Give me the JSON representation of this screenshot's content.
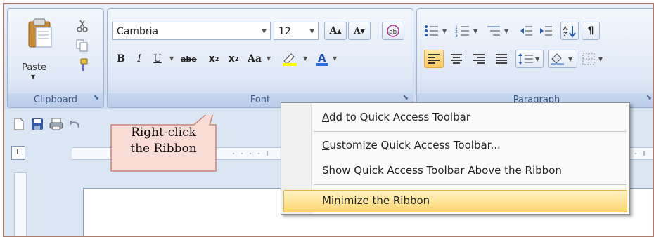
{
  "clipboard": {
    "paste_label": "Paste",
    "group_label": "Clipboard"
  },
  "font": {
    "family": "Cambria",
    "size": "12",
    "grow_label": "A",
    "shrink_label": "A",
    "bold": "B",
    "italic": "I",
    "underline": "U",
    "strike": "abe",
    "subscript": "x",
    "superscript": "x",
    "change_case": "Aa",
    "group_label": "Font"
  },
  "paragraph": {
    "group_label": "Paragraph",
    "pilcrow": "¶"
  },
  "context_menu": {
    "items": [
      {
        "label": "Add to Quick Access Toolbar",
        "mnemonic": "A",
        "rest": "dd to Quick Access Toolbar"
      },
      {
        "label": "Customize Quick Access Toolbar...",
        "mnemonic": "C",
        "rest": "ustomize Quick Access Toolbar..."
      },
      {
        "label": "Show Quick Access Toolbar Above the Ribbon",
        "mnemonic": "S",
        "rest": "how Quick Access Toolbar Above the Ribbon"
      },
      {
        "label": "Minimize the Ribbon",
        "pre": "Mi",
        "mnemonic": "n",
        "rest": "imize the Ribbon"
      }
    ]
  },
  "callout": {
    "line1": "Right-click",
    "line2": "the Ribbon"
  },
  "ruler": {
    "first_tick": "1"
  },
  "colors": {
    "accent_highlight": "#fdd66e",
    "callout_fill": "#fadcd6",
    "callout_border": "#c9847a"
  }
}
